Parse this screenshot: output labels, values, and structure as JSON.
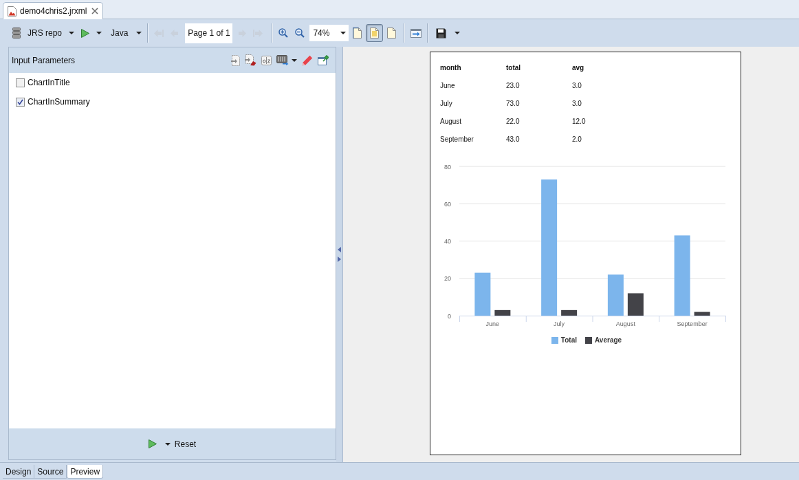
{
  "editor_tab": {
    "title": "demo4chris2.jrxml"
  },
  "toolbar": {
    "repository": "JRS repo",
    "language": "Java",
    "back_buttons": [
      {
        "kind": "first",
        "disabled": true
      },
      {
        "kind": "previous",
        "disabled": true
      }
    ],
    "page_indicator": "Page 1 of 1",
    "forward_buttons": [
      {
        "kind": "next",
        "disabled": true
      },
      {
        "kind": "last",
        "disabled": true
      }
    ],
    "zoom": "74%",
    "view_modes": [
      {
        "selected": false
      },
      {
        "selected": true
      },
      {
        "selected": false
      }
    ]
  },
  "input_parameters": {
    "title": "Input Parameters",
    "parameters": [
      {
        "label": "ChartInTitle",
        "checked": false
      },
      {
        "label": "ChartInSummary",
        "checked": true
      }
    ],
    "reset_label": "Reset"
  },
  "report": {
    "table": {
      "columns": [
        "month",
        "total",
        "avg"
      ],
      "rows": [
        [
          "June",
          "23.0",
          "3.0"
        ],
        [
          "July",
          "73.0",
          "3.0"
        ],
        [
          "August",
          "22.0",
          "12.0"
        ],
        [
          "September",
          "43.0",
          "2.0"
        ]
      ]
    },
    "chart_data": {
      "type": "bar",
      "categories": [
        "June",
        "July",
        "August",
        "September"
      ],
      "series": [
        {
          "name": "Total",
          "color": "#7cb5ec",
          "values": [
            23,
            73,
            22,
            43
          ]
        },
        {
          "name": "Average",
          "color": "#434348",
          "values": [
            3,
            3,
            12,
            2
          ]
        }
      ],
      "ylim": [
        0,
        80
      ],
      "yticks": [
        0,
        20,
        40,
        60,
        80
      ],
      "grid": true,
      "legend": true
    }
  },
  "bottom_tabs": [
    {
      "label": "Design",
      "selected": false
    },
    {
      "label": "Source",
      "selected": false
    },
    {
      "label": "Preview",
      "selected": true
    }
  ]
}
